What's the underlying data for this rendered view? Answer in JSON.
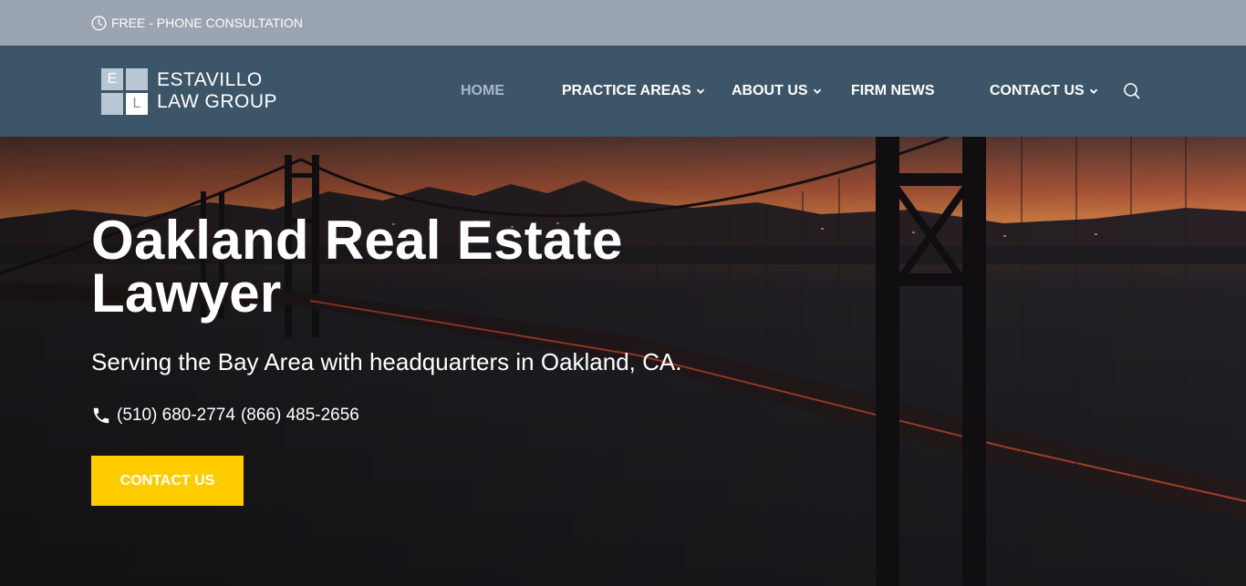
{
  "topbar": {
    "text": "FREE - PHONE CONSULTATION",
    "icon": "clock-icon"
  },
  "logo": {
    "mark_letters": [
      "E",
      "L"
    ],
    "line1": "ESTAVILLO",
    "line2": "LAW GROUP"
  },
  "nav": {
    "items": [
      {
        "label": "HOME",
        "active": true,
        "dropdown": false
      },
      {
        "label": "PRACTICE AREAS",
        "active": false,
        "dropdown": true
      },
      {
        "label": "ABOUT US",
        "active": false,
        "dropdown": true
      },
      {
        "label": "FIRM NEWS",
        "active": false,
        "dropdown": false
      },
      {
        "label": "CONTACT US",
        "active": false,
        "dropdown": true
      }
    ],
    "search_icon": "search-icon"
  },
  "hero": {
    "title_line1": "Oakland Real Estate",
    "title_line2": "Lawyer",
    "subtitle": "Serving the Bay Area with headquarters in Oakland, CA.",
    "phone_icon": "phone-icon",
    "phone_1": "(510) 680-2774",
    "phone_2": "(866) 485-2656",
    "cta_label": "CONTACT US"
  },
  "colors": {
    "topbar_bg": "#9aa5b1",
    "header_bg": "#3d5568",
    "nav_active": "#aab8c6",
    "cta_bg": "#ffcc00",
    "text": "#ffffff"
  }
}
